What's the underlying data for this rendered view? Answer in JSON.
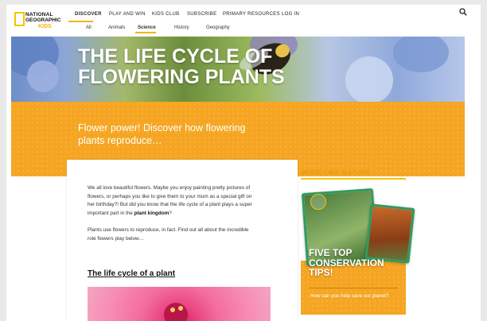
{
  "brand": {
    "line1": "NATIONAL",
    "line2": "GEOGRAPHIC",
    "line3": "KIDS"
  },
  "nav": {
    "items": [
      {
        "label": "DISCOVER",
        "active": true
      },
      {
        "label": "PLAY AND WIN"
      },
      {
        "label": "KIDS CLUB"
      },
      {
        "label": "SUBSCRIBE"
      },
      {
        "label": "PRIMARY RESOURCES"
      },
      {
        "label": "LOG IN"
      }
    ]
  },
  "subnav": {
    "items": [
      {
        "label": "All"
      },
      {
        "label": "Animals"
      },
      {
        "label": "Science",
        "active": true
      },
      {
        "label": "History"
      },
      {
        "label": "Geography"
      }
    ]
  },
  "hero": {
    "title": "THE LIFE CYCLE OF FLOWERING PLANTS",
    "tagline": "Flower power! Discover how flowering plants reproduce…"
  },
  "article": {
    "p1_start": "We all love beautiful flowers. Maybe you enjoy painting pretty pictures of flowers, or perhaps you like to give them to your mum as a special gift on her birthday?! But did you know that the life cycle of a plant plays a super important part in the ",
    "p1_bold": "plant kingdom",
    "p1_end": "?",
    "p2": "Plants use flowers to reproduce, in fact. Find out all about the incredible role flowers play below…",
    "heading": "The life cycle of a plant"
  },
  "sidebar": {
    "title": "MORE LIKE NATURE",
    "card_title": "FIVE TOP CONSERVATION TIPS!",
    "card_desc": "How can you help save our planet?"
  },
  "icons": {
    "search": "search-icon"
  },
  "colors": {
    "accent": "#f5a521",
    "brand_yellow": "#f5c400",
    "card_frame": "#2f9a5f"
  }
}
